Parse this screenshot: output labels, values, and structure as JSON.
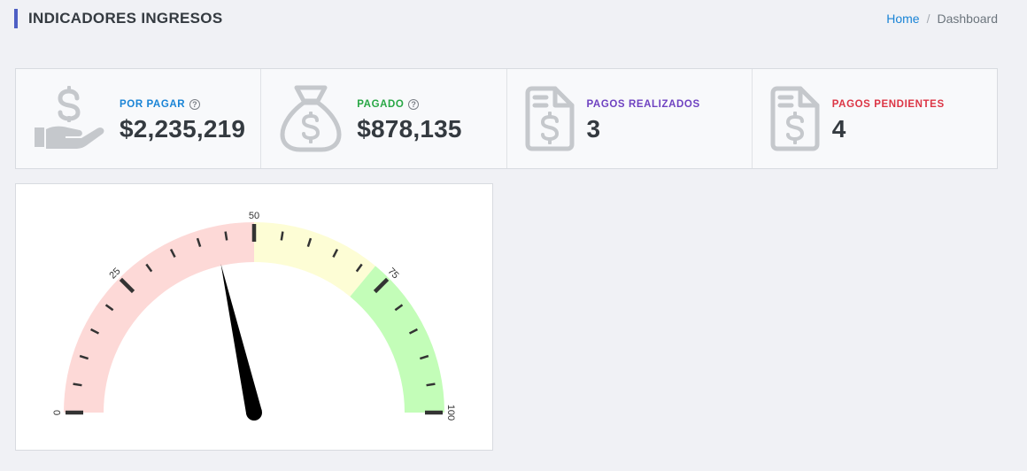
{
  "header": {
    "title": "INDICADORES INGRESOS",
    "breadcrumb": {
      "home": "Home",
      "separator": "/",
      "current": "Dashboard"
    }
  },
  "cards": [
    {
      "label": "POR PAGAR",
      "value": "$2,235,219",
      "label_color": "#1a84d6",
      "icon": "hand-dollar-icon",
      "has_help": true,
      "help_glyph": "?"
    },
    {
      "label": "PAGADO",
      "value": "$878,135",
      "label_color": "#28a745",
      "icon": "money-bag-icon",
      "has_help": true,
      "help_glyph": "?"
    },
    {
      "label": "PAGOS REALIZADOS",
      "value": "3",
      "label_color": "#6f42c1",
      "icon": "invoice-dollar-icon",
      "has_help": false
    },
    {
      "label": "PAGOS PENDIENTES",
      "value": "4",
      "label_color": "#dc3545",
      "icon": "invoice-dollar-icon",
      "has_help": false
    }
  ],
  "chart_data": {
    "type": "gauge",
    "min": 0,
    "max": 100,
    "value": 43,
    "major_ticks": [
      0,
      25,
      50,
      75,
      100
    ],
    "tick_labels": [
      "0",
      "25",
      "50",
      "75",
      "100"
    ],
    "bands": [
      {
        "from": 0,
        "to": 50,
        "color": "#fdd9d7"
      },
      {
        "from": 50,
        "to": 72,
        "color": "#fdfdd5"
      },
      {
        "from": 72,
        "to": 100,
        "color": "#c3fdb8"
      }
    ]
  }
}
